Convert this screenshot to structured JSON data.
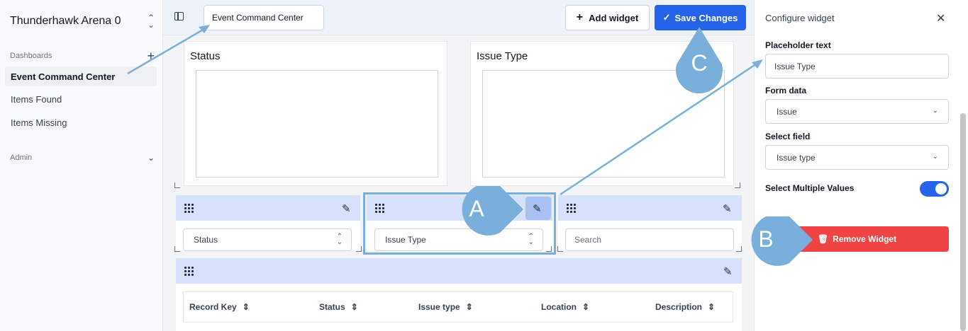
{
  "sidebar": {
    "workspace": "Thunderhawk Arena 0",
    "dashboards_label": "Dashboards",
    "items": [
      {
        "label": "Event Command Center"
      },
      {
        "label": "Items Found"
      },
      {
        "label": "Items Missing"
      }
    ],
    "admin_label": "Admin"
  },
  "topbar": {
    "title_value": "Event Command Center",
    "add_widget_label": "Add widget",
    "save_label": "Save Changes"
  },
  "cards": {
    "status_title": "Status",
    "issue_type_title": "Issue Type"
  },
  "filters": {
    "status": "Status",
    "issue_type": "Issue Type",
    "search_placeholder": "Search"
  },
  "table": {
    "columns": [
      "Record Key",
      "Status",
      "Issue type",
      "Location",
      "Description"
    ]
  },
  "config_panel": {
    "title": "Configure widget",
    "placeholder_label": "Placeholder text",
    "placeholder_value": "Issue Type",
    "form_data_label": "Form data",
    "form_data_value": "Issue",
    "select_field_label": "Select field",
    "select_field_value": "Issue type",
    "multi_label": "Select Multiple Values",
    "multi_enabled": true,
    "remove_label": "Remove Widget"
  },
  "annotations": {
    "a": "A",
    "b": "B",
    "c": "C"
  },
  "colors": {
    "accent": "#2563eb",
    "danger": "#ef4444",
    "annotation": "#7aaedb"
  }
}
